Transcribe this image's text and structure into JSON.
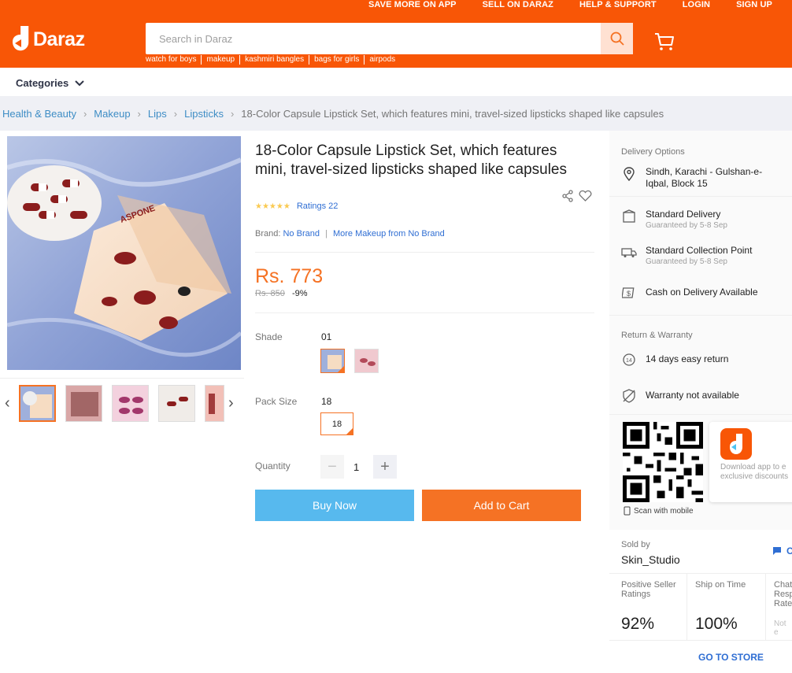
{
  "header": {
    "top_links": [
      "SAVE MORE ON APP",
      "SELL ON DARAZ",
      "HELP & SUPPORT",
      "LOGIN",
      "SIGN UP"
    ],
    "logo_text": "Daraz",
    "search_placeholder": "Search in Daraz",
    "suggestions": [
      "watch for boys",
      "makeup",
      "kashmiri bangles",
      "bags for girls",
      "airpods"
    ],
    "brand_color": "#f85606"
  },
  "nav": {
    "categories_label": "Categories"
  },
  "breadcrumb": {
    "items": [
      "Health & Beauty",
      "Makeup",
      "Lips",
      "Lipsticks"
    ],
    "current": "18-Color Capsule Lipstick Set, which features mini, travel-sized lipsticks shaped like capsules"
  },
  "product": {
    "title": "18-Color Capsule Lipstick Set, which features mini, travel-sized lipsticks shaped like capsules",
    "ratings_text": "Ratings 22",
    "rating_stars": 5,
    "brand_label": "Brand:",
    "brand_name": "No Brand",
    "more_from": "More Makeup from No Brand",
    "price": "Rs. 773",
    "old_price": "Rs. 850",
    "discount": "-9%",
    "shade_label": "Shade",
    "shade_value": "01",
    "pack_label": "Pack Size",
    "pack_value": "18",
    "pack_option": "18",
    "quantity_label": "Quantity",
    "quantity_value": "1",
    "buy_now": "Buy Now",
    "add_to_cart": "Add to Cart"
  },
  "delivery": {
    "heading": "Delivery Options",
    "location": "Sindh, Karachi - Gulshan-e-Iqbal, Block 15",
    "standard_title": "Standard Delivery",
    "standard_sub": "Guaranteed by 5-8 Sep",
    "collection_title": "Standard Collection Point",
    "collection_sub": "Guaranteed by 5-8 Sep",
    "cod": "Cash on Delivery Available"
  },
  "warranty": {
    "heading": "Return & Warranty",
    "return": "14 days easy return",
    "warranty": "Warranty not available"
  },
  "app": {
    "scan_label": "Scan with mobile",
    "download_text_line1": "Download app to e",
    "download_text_line2": "exclusive discounts"
  },
  "seller": {
    "sold_by_label": "Sold by",
    "name": "Skin_Studio",
    "chat_label": "C",
    "stats": [
      {
        "label": "Positive Seller Ratings",
        "value": "92%"
      },
      {
        "label": "Ship on Time",
        "value": "100%"
      },
      {
        "label": "Chat Response Rate",
        "value": "Not e"
      }
    ],
    "go_to_store": "GO TO STORE"
  }
}
